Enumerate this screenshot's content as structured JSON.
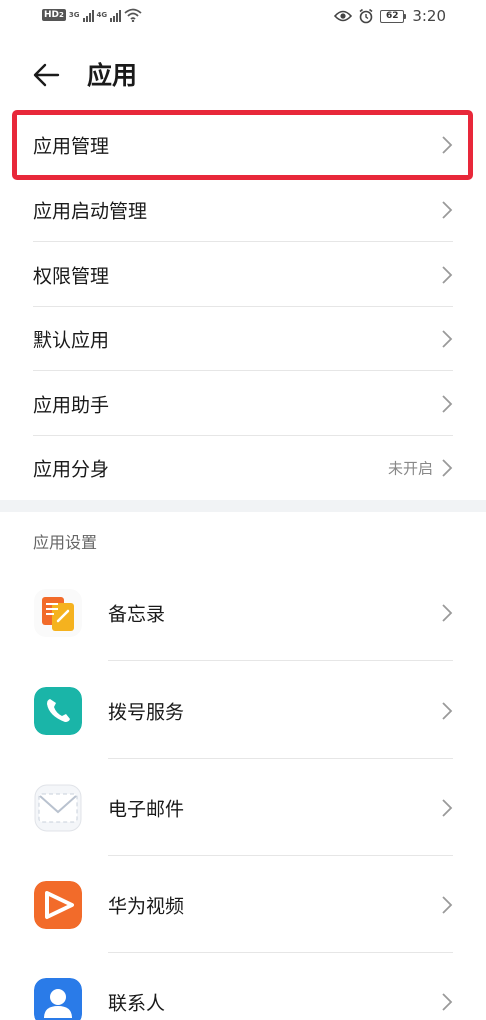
{
  "status_bar": {
    "network_hd": "HD",
    "network_hd_sub": "2",
    "network_a": "3G",
    "network_b": "4G",
    "battery": "62",
    "time": "3:20"
  },
  "header": {
    "title": "应用"
  },
  "menu": [
    {
      "label": "应用管理",
      "value": ""
    },
    {
      "label": "应用启动管理",
      "value": ""
    },
    {
      "label": "权限管理",
      "value": ""
    },
    {
      "label": "默认应用",
      "value": ""
    },
    {
      "label": "应用助手",
      "value": ""
    },
    {
      "label": "应用分身",
      "value": "未开启"
    }
  ],
  "app_settings": {
    "section_title": "应用设置",
    "apps": [
      {
        "label": "备忘录",
        "icon": "notepad-icon"
      },
      {
        "label": "拨号服务",
        "icon": "phone-icon"
      },
      {
        "label": "电子邮件",
        "icon": "mail-icon"
      },
      {
        "label": "华为视频",
        "icon": "video-icon"
      },
      {
        "label": "联系人",
        "icon": "contacts-icon"
      }
    ]
  },
  "colors": {
    "highlight": "#e8283a",
    "phone_icon": "#1ab5a8",
    "video_icon": "#f26b2a",
    "contacts_icon": "#2a7be8",
    "notepad_icon": "#f5a623"
  }
}
